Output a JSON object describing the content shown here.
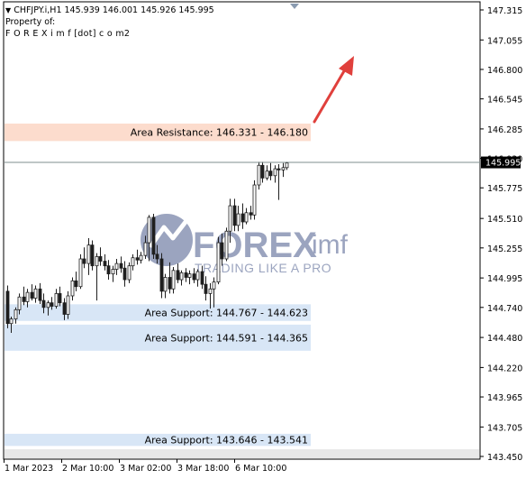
{
  "header": {
    "symbol_line": "CHFJPY.i,H1  145.939 146.001 145.926 145.995",
    "property_label": "Property of:",
    "property_value": "F O R E X i m f [dot] c o m2"
  },
  "watermark": {
    "brand_main": "FOREX",
    "brand_suffix": "imf",
    "tagline": "TRADING LIKE A PRO"
  },
  "colors": {
    "resistance_zone": "#fcdccd",
    "support_zone": "#d8e6f6",
    "candle": "#1f1f1f",
    "arrow": "#e0403c",
    "price_line": "#7f8f8f",
    "brand": "#4a5b8c"
  },
  "chart_data": {
    "type": "candlestick",
    "symbol": "CHFJPY.i",
    "timeframe": "H1",
    "last_price": "145.995",
    "ylim": [
      143.45,
      147.35
    ],
    "y_ticks": [
      "147.315",
      "147.055",
      "146.800",
      "146.545",
      "146.285",
      "146.030",
      "145.775",
      "145.510",
      "145.255",
      "144.995",
      "144.740",
      "144.480",
      "144.220",
      "143.965",
      "143.705",
      "143.450"
    ],
    "x_ticks": [
      "1 Mar 2023",
      "2 Mar 10:00",
      "3 Mar 02:00",
      "3 Mar 18:00",
      "6 Mar 10:00"
    ],
    "zones": [
      {
        "kind": "resistance",
        "label": "Area Resistance: 146.331 - 146.180",
        "top": 146.331,
        "bottom": 146.18
      },
      {
        "kind": "support",
        "label": "Area Support: 144.767 - 144.623",
        "top": 144.767,
        "bottom": 144.623
      },
      {
        "kind": "support",
        "label": "Area Support: 144.591 - 144.365",
        "top": 144.591,
        "bottom": 144.365
      },
      {
        "kind": "support",
        "label": "Area Support: 143.646 - 143.541",
        "top": 143.646,
        "bottom": 143.541
      }
    ],
    "candles": [
      [
        144.88,
        144.93,
        144.56,
        144.6
      ],
      [
        144.6,
        144.66,
        144.52,
        144.64
      ],
      [
        144.64,
        144.74,
        144.6,
        144.72
      ],
      [
        144.72,
        144.86,
        144.68,
        144.83
      ],
      [
        144.83,
        144.92,
        144.76,
        144.79
      ],
      [
        144.79,
        144.9,
        144.74,
        144.87
      ],
      [
        144.87,
        144.94,
        144.8,
        144.82
      ],
      [
        144.82,
        144.93,
        144.78,
        144.9
      ],
      [
        144.9,
        144.95,
        144.77,
        144.8
      ],
      [
        144.8,
        144.86,
        144.69,
        144.74
      ],
      [
        144.74,
        144.8,
        144.67,
        144.78
      ],
      [
        144.78,
        144.83,
        144.72,
        144.75
      ],
      [
        144.75,
        144.9,
        144.73,
        144.86
      ],
      [
        144.86,
        144.92,
        144.75,
        144.78
      ],
      [
        144.78,
        144.82,
        144.63,
        144.68
      ],
      [
        144.68,
        144.88,
        144.64,
        144.84
      ],
      [
        144.84,
        145.0,
        144.8,
        144.97
      ],
      [
        144.97,
        145.05,
        144.88,
        144.92
      ],
      [
        144.92,
        145.2,
        144.9,
        145.16
      ],
      [
        145.16,
        145.26,
        145.08,
        145.12
      ],
      [
        145.12,
        145.34,
        145.02,
        145.28
      ],
      [
        145.28,
        145.32,
        145.06,
        145.1
      ],
      [
        145.1,
        145.21,
        144.8,
        145.18
      ],
      [
        145.18,
        145.26,
        145.1,
        145.14
      ],
      [
        145.14,
        145.2,
        145.06,
        145.1
      ],
      [
        145.1,
        145.15,
        144.98,
        145.03
      ],
      [
        145.03,
        145.1,
        144.96,
        145.07
      ],
      [
        145.07,
        145.16,
        145.02,
        145.12
      ],
      [
        145.12,
        145.18,
        145.04,
        145.08
      ],
      [
        145.08,
        145.14,
        144.92,
        144.98
      ],
      [
        144.98,
        145.13,
        144.95,
        145.1
      ],
      [
        145.1,
        145.2,
        145.06,
        145.17
      ],
      [
        145.17,
        145.24,
        145.11,
        145.15
      ],
      [
        145.15,
        145.22,
        145.12,
        145.19
      ],
      [
        145.19,
        145.36,
        145.16,
        145.3
      ],
      [
        145.3,
        145.54,
        145.14,
        145.52
      ],
      [
        145.52,
        145.55,
        145.16,
        145.2
      ],
      [
        145.2,
        145.28,
        145.12,
        145.16
      ],
      [
        145.16,
        145.21,
        144.82,
        144.88
      ],
      [
        144.88,
        145.03,
        144.82,
        145.0
      ],
      [
        145.0,
        145.13,
        144.86,
        144.9
      ],
      [
        144.9,
        145.09,
        144.86,
        145.06
      ],
      [
        145.06,
        145.12,
        144.95,
        144.98
      ],
      [
        144.98,
        145.06,
        144.93,
        145.04
      ],
      [
        145.04,
        145.08,
        144.96,
        145.0
      ],
      [
        145.0,
        145.06,
        144.94,
        145.03
      ],
      [
        145.03,
        145.08,
        144.95,
        144.98
      ],
      [
        144.98,
        145.07,
        144.92,
        145.05
      ],
      [
        145.05,
        145.1,
        144.9,
        144.94
      ],
      [
        144.94,
        145.01,
        144.8,
        144.86
      ],
      [
        144.86,
        144.95,
        144.73,
        144.9
      ],
      [
        144.9,
        145.0,
        144.74,
        144.96
      ],
      [
        144.96,
        145.35,
        144.94,
        145.3
      ],
      [
        145.3,
        145.38,
        145.1,
        145.16
      ],
      [
        145.16,
        145.43,
        145.14,
        145.4
      ],
      [
        145.4,
        145.68,
        145.3,
        145.62
      ],
      [
        145.62,
        145.68,
        145.4,
        145.45
      ],
      [
        145.45,
        145.62,
        145.4,
        145.55
      ],
      [
        145.55,
        145.64,
        145.42,
        145.48
      ],
      [
        145.48,
        145.6,
        145.46,
        145.56
      ],
      [
        145.56,
        145.62,
        145.5,
        145.54
      ],
      [
        145.54,
        145.84,
        145.5,
        145.8
      ],
      [
        145.8,
        146.0,
        145.76,
        145.97
      ],
      [
        145.97,
        146.0,
        145.82,
        145.86
      ],
      [
        145.86,
        145.97,
        145.84,
        145.92
      ],
      [
        145.92,
        145.99,
        145.84,
        145.88
      ],
      [
        145.88,
        145.97,
        145.82,
        145.94
      ],
      [
        145.94,
        145.98,
        145.67,
        145.93
      ],
      [
        145.93,
        145.99,
        145.87,
        145.95
      ],
      [
        145.95,
        146.0,
        145.93,
        145.99
      ]
    ]
  }
}
